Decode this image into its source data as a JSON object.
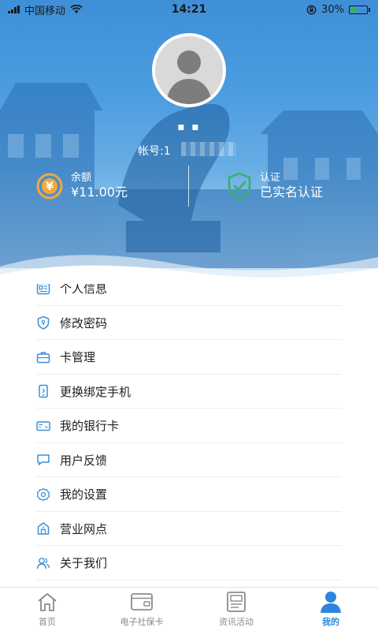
{
  "status_bar": {
    "carrier": "中国移动",
    "time": "14:21",
    "battery": "30%"
  },
  "profile": {
    "username_masked": "▪ ▪",
    "account_label": "帐号:1"
  },
  "stats": {
    "balance": {
      "label": "余额",
      "value": "¥11.00元",
      "icon": "yuan-coin-icon"
    },
    "auth": {
      "label": "认证",
      "value": "已实名认证",
      "icon": "shield-check-icon"
    }
  },
  "menu": {
    "items": [
      {
        "label": "个人信息",
        "icon": "id-card-icon"
      },
      {
        "label": "修改密码",
        "icon": "password-shield-icon"
      },
      {
        "label": "卡管理",
        "icon": "briefcase-icon"
      },
      {
        "label": "更换绑定手机",
        "icon": "phone-icon"
      },
      {
        "label": "我的银行卡",
        "icon": "bank-card-icon"
      },
      {
        "label": "用户反馈",
        "icon": "chat-icon"
      },
      {
        "label": "我的设置",
        "icon": "gear-icon"
      },
      {
        "label": "营业网点",
        "icon": "building-icon"
      },
      {
        "label": "关于我们",
        "icon": "users-icon"
      }
    ]
  },
  "tabbar": {
    "tabs": [
      {
        "label": "首页",
        "icon": "home-icon",
        "active": false
      },
      {
        "label": "电子社保卡",
        "icon": "card-icon",
        "active": false
      },
      {
        "label": "资讯活动",
        "icon": "news-icon",
        "active": false
      },
      {
        "label": "我的",
        "icon": "person-icon",
        "active": true
      }
    ]
  },
  "colors": {
    "primary": "#2d86dd",
    "icon_blue": "#3a8fd9",
    "balance_coin": "#f2a93b",
    "auth_shield": "#34b36b"
  }
}
